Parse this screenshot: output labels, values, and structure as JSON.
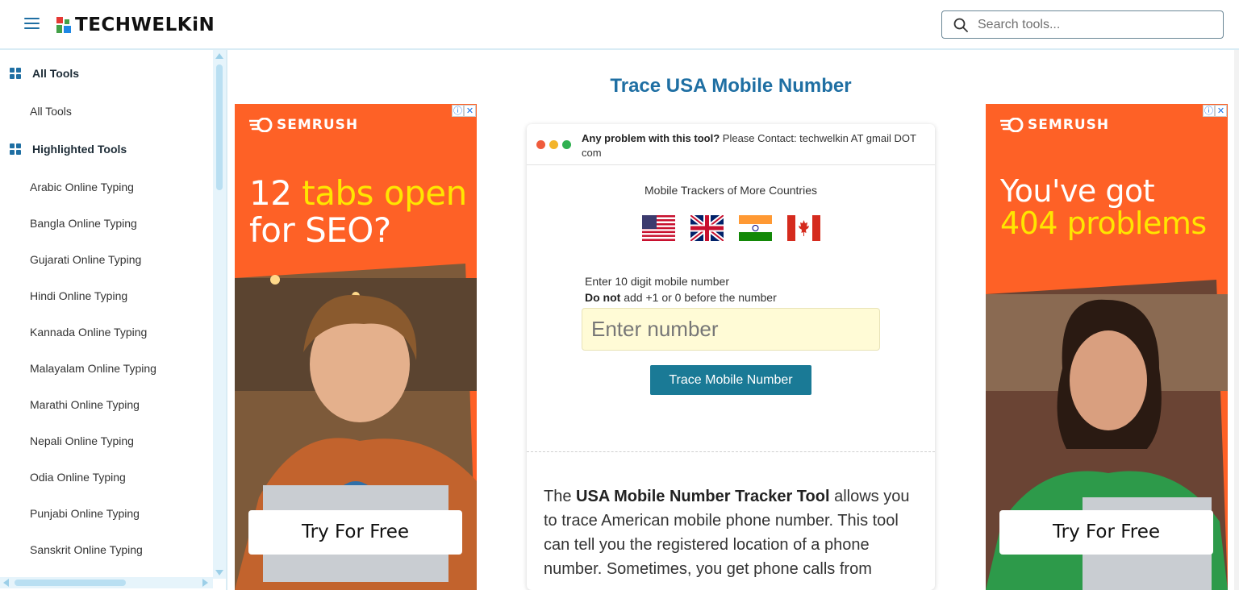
{
  "header": {
    "logo_text": "TECHWELKiN",
    "search_placeholder": "Search tools..."
  },
  "sidebar": {
    "sections": [
      {
        "title": "All Tools",
        "items": [
          "All Tools"
        ]
      },
      {
        "title": "Highlighted Tools",
        "items": [
          "Arabic Online Typing",
          "Bangla Online Typing",
          "Gujarati Online Typing",
          "Hindi Online Typing",
          "Kannada Online Typing",
          "Malayalam Online Typing",
          "Marathi Online Typing",
          "Nepali Online Typing",
          "Odia Online Typing",
          "Punjabi Online Typing",
          "Sanskrit Online Typing"
        ]
      }
    ]
  },
  "main": {
    "title": "Trace USA Mobile Number",
    "notice_bold": "Any problem with this tool?",
    "notice_rest": " Please Contact: techwelkin AT gmail DOT com",
    "trackers_label": "Mobile Trackers of More Countries",
    "flags": [
      "USA",
      "UK",
      "India",
      "Canada"
    ],
    "form": {
      "label_line1": "Enter 10 digit mobile number",
      "label_line2_bold": "Do not",
      "label_line2_rest": " add +1 or 0 before the number",
      "input_placeholder": "Enter number",
      "button_label": "Trace Mobile Number"
    },
    "description": {
      "pre": "The ",
      "bold": "USA Mobile Number Tracker Tool",
      "post": " allows you to trace American mobile phone number. This tool can tell you the registered location of a phone number. Sometimes, you get phone calls from"
    }
  },
  "ads": {
    "left": {
      "brand": "SEMRUSH",
      "headline_white1": "12 ",
      "headline_yellow": "tabs open",
      "headline_white2": "for SEO?",
      "cta": "Try For Free"
    },
    "right": {
      "brand": "SEMRUSH",
      "headline_white": "You've got",
      "headline_yellow": "404 problems",
      "cta": "Try For Free"
    }
  },
  "colors": {
    "accent": "#1f6fa3",
    "button": "#1a7a96",
    "ad_orange": "#fe6126",
    "ad_yellow": "#ffe600",
    "input_bg": "#fffbd6"
  },
  "icons": [
    "hamburger-icon",
    "search-icon",
    "grid-icon",
    "semrush-logo-icon",
    "ad-info-icon",
    "ad-close-icon"
  ]
}
